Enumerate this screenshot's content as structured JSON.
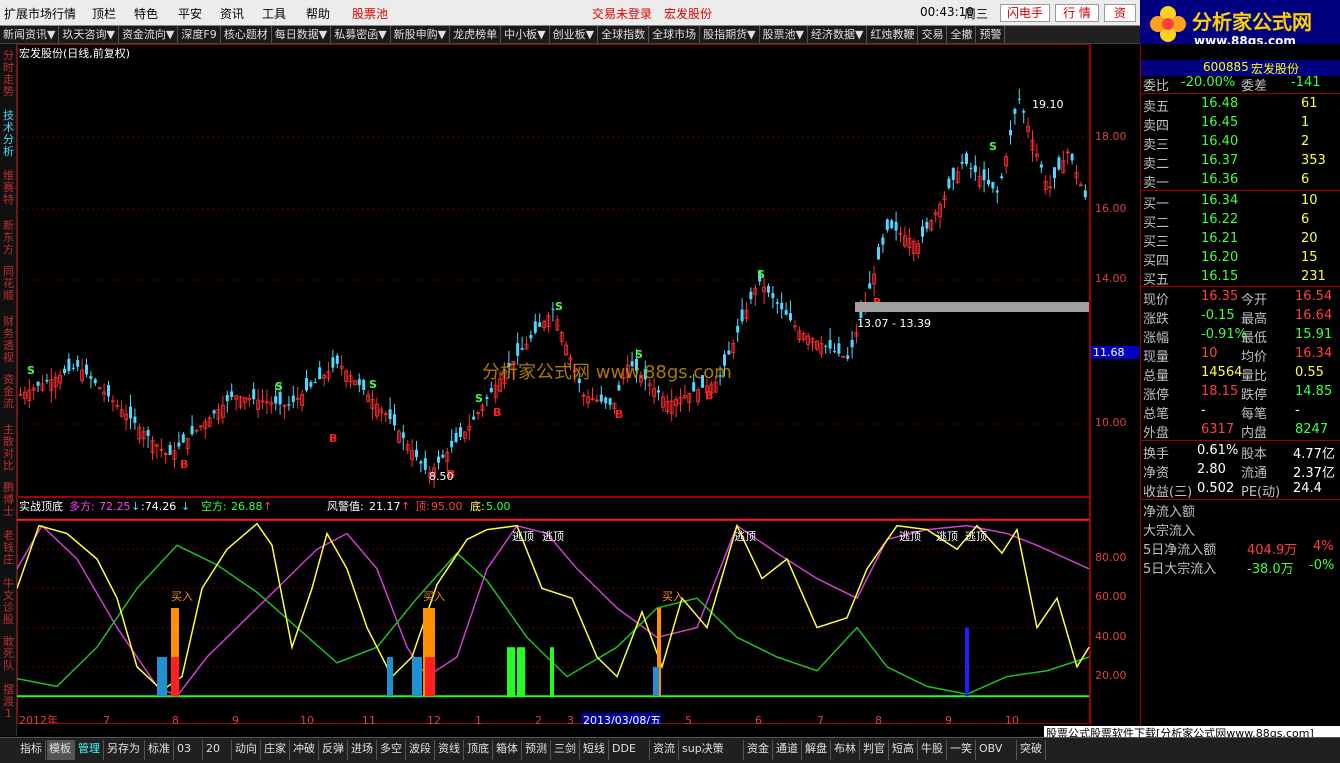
{
  "menubar": {
    "items": [
      "扩展市场行情",
      "顶栏",
      "特色",
      "平安",
      "资讯",
      "工具",
      "帮助"
    ],
    "stock_pool": "股票池",
    "trade_status": "交易未登录",
    "stock_name": "宏发股份",
    "time": "00:43:10",
    "weekday": "周三",
    "flash_btn": "闪电手",
    "quote_btn": "行 情",
    "info_btn": "资"
  },
  "logo": {
    "title": "分析家公式网",
    "url": "www.88gs.com"
  },
  "navbar": [
    "新闻资讯▼",
    "玖天咨询▼",
    "资金流向▼",
    "深度F9",
    "核心题材",
    "每日数据▼",
    "私募密函▼",
    "新股申购▼",
    "龙虎榜单",
    "中小板▼",
    "创业板▼",
    "全球指数",
    "全球市场",
    "股指期货▼",
    "股票池▼",
    "经济数据▼",
    "红烛教鞭",
    "交易",
    "全撤",
    "预警"
  ],
  "leftbar": [
    "分时走势",
    "技术分析",
    "维赛特",
    "新东方",
    "同花顺",
    "财务透视",
    "资金流",
    "主散对比",
    "鹏博士",
    "老钱庄",
    "牛文诊股",
    "敢死队",
    "摆渡1"
  ],
  "chart": {
    "title": "宏发股份(日线,前复权)",
    "price_levels": [
      "18.00",
      "16.00",
      "14.00",
      "10.00"
    ],
    "current_price_tag": "11.68",
    "high_label": "19.10",
    "low_label": "8.50",
    "band_label": "13.07 - 13.39",
    "watermark": "分析家公式网 www.88gs.com",
    "buy_marker": "B",
    "sell_marker": "S",
    "colors": {
      "up": "#ff3030",
      "down": "#4fd8ff",
      "band": "#a0a0a0"
    }
  },
  "indicator": {
    "name": "实战顶底",
    "duo_label": "多方:",
    "duo_value": "72.25",
    "value2": ":74.26",
    "kong_label": "空方:",
    "kong_value": "26.88",
    "risk_label": "风警值:",
    "risk_value": "21.17",
    "top_label": "顶:",
    "top_value": "95.00",
    "bottom_label": "底:",
    "bottom_value": "5.00",
    "levels": [
      "80.00",
      "60.00",
      "40.00",
      "20.00"
    ],
    "buy_text": "买入",
    "top_text": "逃顶"
  },
  "timeaxis": {
    "labels": [
      "2012年",
      "7",
      "8",
      "9",
      "10",
      "11",
      "12",
      "1",
      "2",
      "3",
      "2013/03/08/五",
      "5",
      "6",
      "7",
      "8",
      "9",
      "10"
    ]
  },
  "quote": {
    "code": "600885",
    "name": "宏发股份",
    "weibi_label": "委比",
    "weibi": "-20.00%",
    "weicha_label": "委差",
    "weicha": "-141",
    "sell": [
      {
        "label": "卖五",
        "price": "16.48",
        "vol": "61"
      },
      {
        "label": "卖四",
        "price": "16.45",
        "vol": "1"
      },
      {
        "label": "卖三",
        "price": "16.40",
        "vol": "2"
      },
      {
        "label": "卖二",
        "price": "16.37",
        "vol": "353"
      },
      {
        "label": "卖一",
        "price": "16.36",
        "vol": "6"
      }
    ],
    "buy": [
      {
        "label": "买一",
        "price": "16.34",
        "vol": "10"
      },
      {
        "label": "买二",
        "price": "16.22",
        "vol": "6"
      },
      {
        "label": "买三",
        "price": "16.21",
        "vol": "20"
      },
      {
        "label": "买四",
        "price": "16.20",
        "vol": "15"
      },
      {
        "label": "买五",
        "price": "16.15",
        "vol": "231"
      }
    ],
    "stats": [
      {
        "l1": "现价",
        "v1": "16.35",
        "c1": "#ff4040",
        "l2": "今开",
        "v2": "16.54",
        "c2": "#ff4040"
      },
      {
        "l1": "涨跌",
        "v1": "-0.15",
        "c1": "#40ff40",
        "l2": "最高",
        "v2": "16.64",
        "c2": "#ff4040"
      },
      {
        "l1": "涨幅",
        "v1": "-0.91%",
        "c1": "#40ff40",
        "l2": "最低",
        "v2": "15.91",
        "c2": "#40ff40"
      },
      {
        "l1": "现量",
        "v1": "10",
        "c1": "#ff4040",
        "l2": "均价",
        "v2": "16.34",
        "c2": "#ff4040"
      },
      {
        "l1": "总量",
        "v1": "14564",
        "c1": "#ffff40",
        "l2": "量比",
        "v2": "0.55",
        "c2": "#ffff40"
      },
      {
        "l1": "涨停",
        "v1": "18.15",
        "c1": "#ff4040",
        "l2": "跌停",
        "v2": "14.85",
        "c2": "#40ff40"
      },
      {
        "l1": "总笔",
        "v1": "-",
        "c1": "#ffffff",
        "l2": "每笔",
        "v2": "-",
        "c2": "#ffffff"
      },
      {
        "l1": "外盘",
        "v1": "6317",
        "c1": "#ff4040",
        "l2": "内盘",
        "v2": "8247",
        "c2": "#40ff40"
      }
    ],
    "stats2": [
      {
        "l1": "换手",
        "v1": "0.61%",
        "l2": "股本",
        "v2": "4.77亿"
      },
      {
        "l1": "净资",
        "v1": "2.80",
        "l2": "流通",
        "v2": "2.37亿"
      },
      {
        "l1": "收益(三)",
        "v1": "0.502",
        "l2": "PE(动)",
        "v2": "24.4"
      }
    ],
    "flow_title": "净流入额",
    "block_title": "大宗流入",
    "flow5_label": "5日净流入额",
    "flow5_value": "404.9万",
    "flow5_pct": "4%",
    "block5_label": "5日大宗流入",
    "block5_value": "-38.0万",
    "block5_pct": "-0%"
  },
  "bottombar": [
    "指标",
    "模板",
    "管理",
    "另存为",
    "标准",
    "03",
    "20",
    "动向",
    "庄家",
    "冲破",
    "反弹",
    "进场",
    "多空",
    "波段",
    "资线",
    "顶底",
    "箱体",
    "预测",
    "三剑",
    "短线",
    "DDE",
    "资流",
    "sup决策",
    "资金",
    "通道",
    "解盘",
    "布林",
    "判官",
    "短高",
    "牛股",
    "一笑",
    "OBV",
    "突破"
  ],
  "promo": "股票公式股票软件下载[分析家公式网www.88gs.com]"
}
